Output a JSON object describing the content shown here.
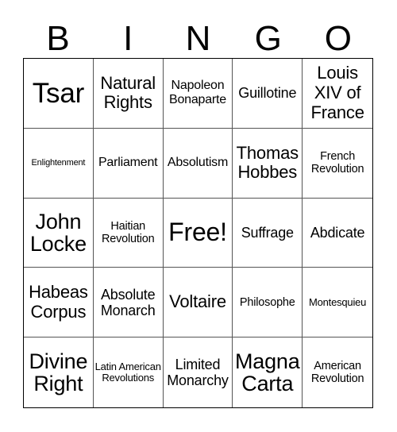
{
  "header": {
    "letters": [
      "B",
      "I",
      "N",
      "G",
      "O"
    ]
  },
  "cells": [
    {
      "text": "Tsar",
      "size": "s-xxl"
    },
    {
      "text": "Natural Rights",
      "size": "s-lg"
    },
    {
      "text": "Napoleon Bonaparte",
      "size": "s-sm"
    },
    {
      "text": "Guillotine",
      "size": "s-md"
    },
    {
      "text": "Louis XIV of France",
      "size": "s-lg"
    },
    {
      "text": "Enlightenment",
      "size": "s-tiny"
    },
    {
      "text": "Parliament",
      "size": "s-sm"
    },
    {
      "text": "Absolutism",
      "size": "s-sm"
    },
    {
      "text": "Thomas Hobbes",
      "size": "s-lg"
    },
    {
      "text": "French Revolution",
      "size": "s-xs"
    },
    {
      "text": "John Locke",
      "size": "s-xl"
    },
    {
      "text": "Haitian Revolution",
      "size": "s-xs"
    },
    {
      "text": "Free!",
      "size": "s-free"
    },
    {
      "text": "Suffrage",
      "size": "s-md"
    },
    {
      "text": "Abdicate",
      "size": "s-md"
    },
    {
      "text": "Habeas Corpus",
      "size": "s-lg"
    },
    {
      "text": "Absolute Monarch",
      "size": "s-md"
    },
    {
      "text": "Voltaire",
      "size": "s-lg"
    },
    {
      "text": "Philosophe",
      "size": "s-xs"
    },
    {
      "text": "Montesquieu",
      "size": "s-xxs"
    },
    {
      "text": "Divine Right",
      "size": "s-xl"
    },
    {
      "text": "Latin American Revolutions",
      "size": "s-xxs"
    },
    {
      "text": "Limited Monarchy",
      "size": "s-md"
    },
    {
      "text": "Magna Carta",
      "size": "s-xl"
    },
    {
      "text": "American Revolution",
      "size": "s-xs"
    }
  ]
}
